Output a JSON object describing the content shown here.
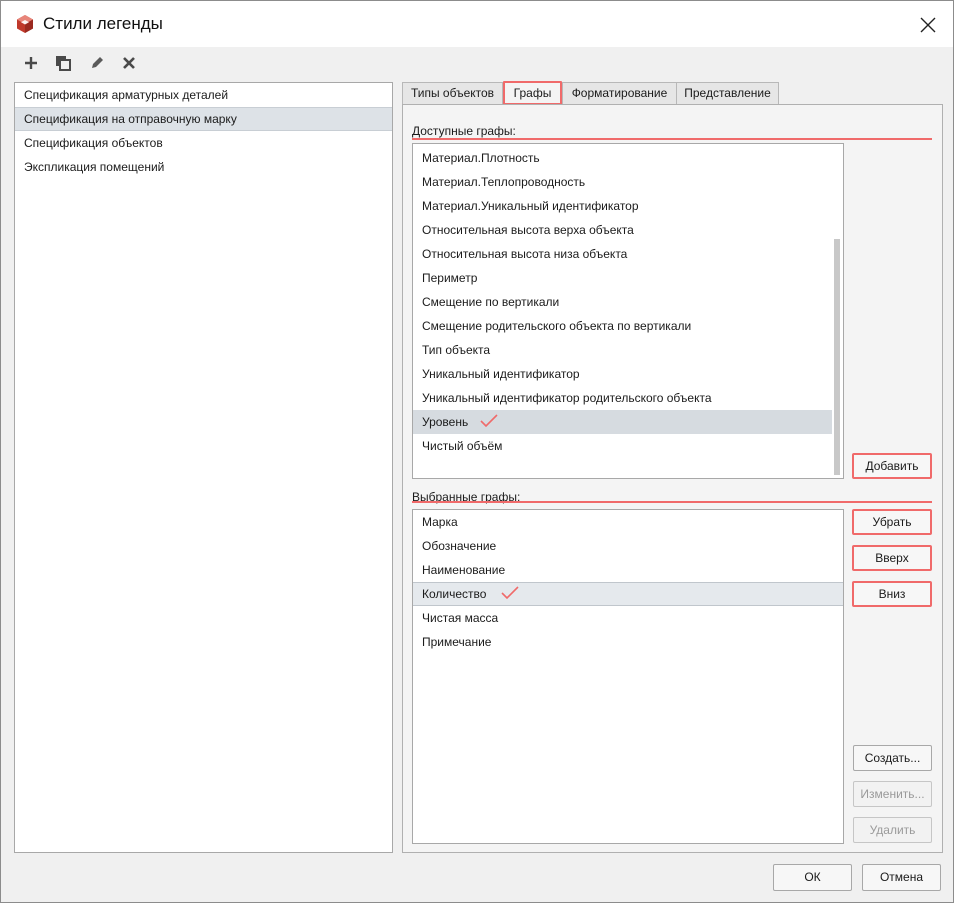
{
  "window": {
    "title": "Стили легенды"
  },
  "toolbar": [
    {
      "name": "add-icon"
    },
    {
      "name": "copy-icon"
    },
    {
      "name": "edit-icon"
    },
    {
      "name": "delete-icon"
    }
  ],
  "styles": [
    "Спецификация арматурных деталей",
    "Спецификация на отправочную марку",
    "Спецификация объектов",
    "Экспликация помещений"
  ],
  "tabs": [
    "Типы объектов",
    "Графы",
    "Форматирование",
    "Представление"
  ],
  "available": {
    "label": "Доступные графы:",
    "items": [
      "Материал.Плотность",
      "Материал.Теплопроводность",
      "Материал.Уникальный идентификатор",
      "Относительная высота верха объекта",
      "Относительная высота низа объекта",
      "Периметр",
      "Смещение по вертикали",
      "Смещение родительского объекта по вертикали",
      "Тип объекта",
      "Уникальный идентификатор",
      "Уникальный идентификатор родительского объекта",
      "Уровень",
      "Чистый объём"
    ],
    "add_button": "Добавить"
  },
  "selected": {
    "label": "Выбранные графы:",
    "items": [
      "Марка",
      "Обозначение",
      "Наименование",
      "Количество",
      "Чистая масса",
      "Примечание"
    ],
    "remove_button": "Убрать",
    "up_button": "Вверх",
    "down_button": "Вниз",
    "create_button": "Создать...",
    "change_button": "Изменить...",
    "delete_button": "Удалить"
  },
  "footer": {
    "ok": "ОК",
    "cancel": "Отмена"
  },
  "colors": {
    "annotation": "#f06a6a",
    "selection": "#d6dbe0"
  }
}
